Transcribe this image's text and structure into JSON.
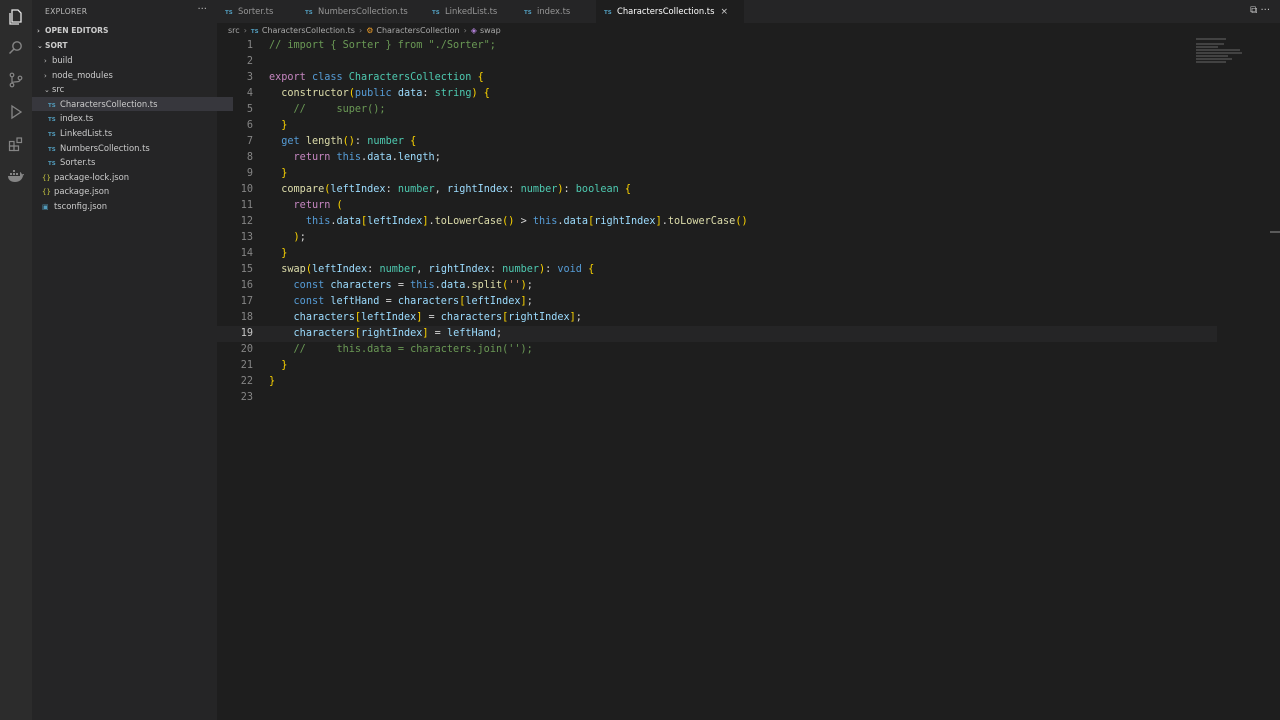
{
  "activity_bar": {
    "icons": [
      "files-icon",
      "search-icon",
      "source-control-icon",
      "run-debug-icon",
      "extensions-icon",
      "docker-icon"
    ]
  },
  "sidebar": {
    "title": "EXPLORER",
    "more": "···",
    "open_editors": "OPEN EDITORS",
    "root": "SORT",
    "items": [
      {
        "label": "build",
        "kind": "folder",
        "expanded": false
      },
      {
        "label": "node_modules",
        "kind": "folder",
        "expanded": false
      },
      {
        "label": "src",
        "kind": "folder",
        "expanded": true
      },
      {
        "label": "CharactersCollection.ts",
        "kind": "ts",
        "selected": true
      },
      {
        "label": "index.ts",
        "kind": "ts"
      },
      {
        "label": "LinkedList.ts",
        "kind": "ts"
      },
      {
        "label": "NumbersCollection.ts",
        "kind": "ts"
      },
      {
        "label": "Sorter.ts",
        "kind": "ts"
      },
      {
        "label": "package-lock.json",
        "kind": "json"
      },
      {
        "label": "package.json",
        "kind": "json"
      },
      {
        "label": "tsconfig.json",
        "kind": "json"
      }
    ],
    "ts_badge": "TS",
    "json_badge": "{}"
  },
  "tabs": [
    {
      "label": "Sorter.ts",
      "active": false
    },
    {
      "label": "NumbersCollection.ts",
      "active": false
    },
    {
      "label": "LinkedList.ts",
      "active": false
    },
    {
      "label": "index.ts",
      "active": false
    },
    {
      "label": "CharactersCollection.ts",
      "active": true
    }
  ],
  "tab_close": "×",
  "tab_actions": "⧉ ···",
  "breadcrumb": {
    "folder": "src",
    "file": "CharactersCollection.ts",
    "class": "CharactersCollection",
    "method": "swap"
  },
  "editor": {
    "current_line": 19,
    "line_numbers": [
      "1",
      "2",
      "3",
      "4",
      "5",
      "6",
      "7",
      "8",
      "9",
      "10",
      "11",
      "12",
      "13",
      "14",
      "15",
      "16",
      "17",
      "18",
      "19",
      "20",
      "21",
      "22",
      "23"
    ],
    "lines": [
      "// import { Sorter } from \"./Sorter\";",
      "",
      "export class CharactersCollection {",
      "  constructor(public data: string) {",
      "    //     super();",
      "  }",
      "  get length(): number {",
      "    return this.data.length;",
      "  }",
      "  compare(leftIndex: number, rightIndex: number): boolean {",
      "    return (",
      "      this.data[leftIndex].toLowerCase() > this.data[rightIndex].toLowerCase()",
      "    );",
      "  }",
      "  swap(leftIndex: number, rightIndex: number): void {",
      "    const characters = this.data.split('');",
      "    const leftHand = characters[leftIndex];",
      "    characters[leftIndex] = characters[rightIndex];",
      "    characters[rightIndex] = leftHand;",
      "    //     this.data = characters.join('');",
      "  }",
      "}",
      ""
    ]
  }
}
